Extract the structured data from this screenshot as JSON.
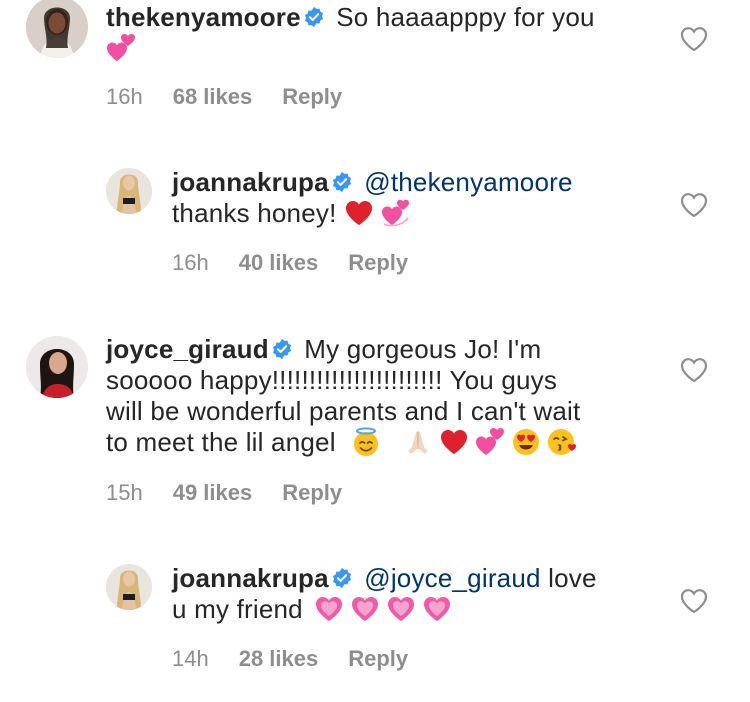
{
  "comments": [
    {
      "username": "thekenyamoore",
      "text": "So haaaapppy for you",
      "emojis": [
        "two-hearts"
      ],
      "time": "16h",
      "likes": "68 likes",
      "reply": "Reply"
    },
    {
      "username": "joannakrupa",
      "mention": "@thekenyamoore",
      "text": "thanks honey!",
      "emojis": [
        "red-heart",
        "revolving-hearts"
      ],
      "time": "16h",
      "likes": "40 likes",
      "reply": "Reply"
    },
    {
      "username": "joyce_giraud",
      "text_line1": "My gorgeous Jo! I'm",
      "text_line2": "sooooo happy!!!!!!!!!!!!!!!!!!!!!!! You guys",
      "text_line3": "will be wonderful parents and I can't wait",
      "text_line4": "to meet the lil angel",
      "emojis": [
        "smiling-face-with-halo",
        "folded-hands",
        "red-heart",
        "two-hearts",
        "heart-eyes",
        "face-blowing-kiss"
      ],
      "time": "15h",
      "likes": "49 likes",
      "reply": "Reply"
    },
    {
      "username": "joannakrupa",
      "mention": "@joyce_giraud",
      "text_line1": "love",
      "text_line2": "u my friend",
      "emojis": [
        "growing-heart",
        "growing-heart",
        "growing-heart",
        "growing-heart"
      ],
      "time": "14h",
      "likes": "28 likes",
      "reply": "Reply"
    }
  ],
  "colors": {
    "username": "#262626",
    "mention": "#003569",
    "meta": "#8e8e8e",
    "verified": "#3897f0"
  }
}
